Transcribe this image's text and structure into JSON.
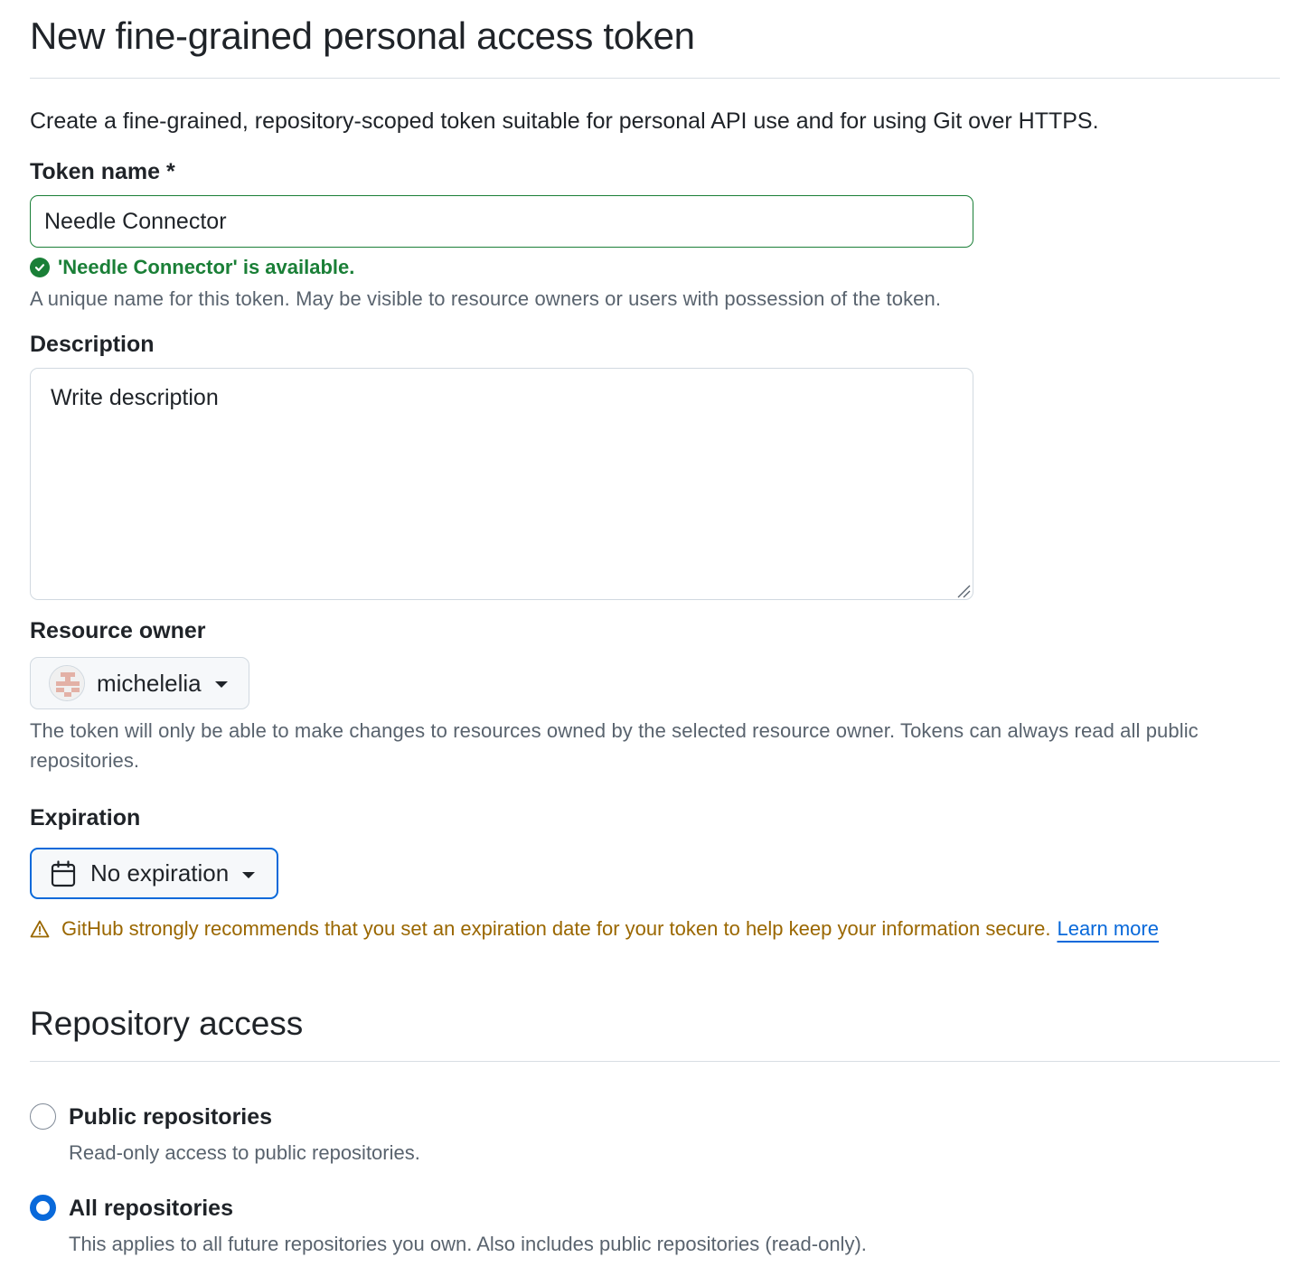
{
  "page": {
    "title": "New fine-grained personal access token",
    "intro": "Create a fine-grained, repository-scoped token suitable for personal API use and for using Git over HTTPS."
  },
  "token_name": {
    "label": "Token name *",
    "value": "Needle Connector",
    "availability": "'Needle Connector' is available.",
    "hint": "A unique name for this token. May be visible to resource owners or users with possession of the token."
  },
  "description": {
    "label": "Description",
    "placeholder": "Write description",
    "value": ""
  },
  "resource_owner": {
    "label": "Resource owner",
    "selected": "michelelia",
    "hint": "The token will only be able to make changes to resources owned by the selected resource owner. Tokens can always read all public repositories."
  },
  "expiration": {
    "label": "Expiration",
    "selected": "No expiration",
    "warning": "GitHub strongly recommends that you set an expiration date for your token to help keep your information secure.",
    "learn_more": "Learn more"
  },
  "repository_access": {
    "title": "Repository access",
    "options": [
      {
        "label": "Public repositories",
        "hint": "Read-only access to public repositories.",
        "checked": false
      },
      {
        "label": "All repositories",
        "hint": "This applies to all future repositories you own. Also includes public repositories (read-only).",
        "checked": true
      }
    ]
  },
  "colors": {
    "success": "#1a7f37",
    "accent": "#0969da",
    "warning": "#9a6700",
    "muted_text": "#59636e",
    "border": "#d1d9e0"
  },
  "icons": {
    "availability": "check-circle-fill-icon",
    "expiration": "calendar-icon",
    "warning": "alert-triangle-icon",
    "dropdown": "triangle-down-icon"
  }
}
